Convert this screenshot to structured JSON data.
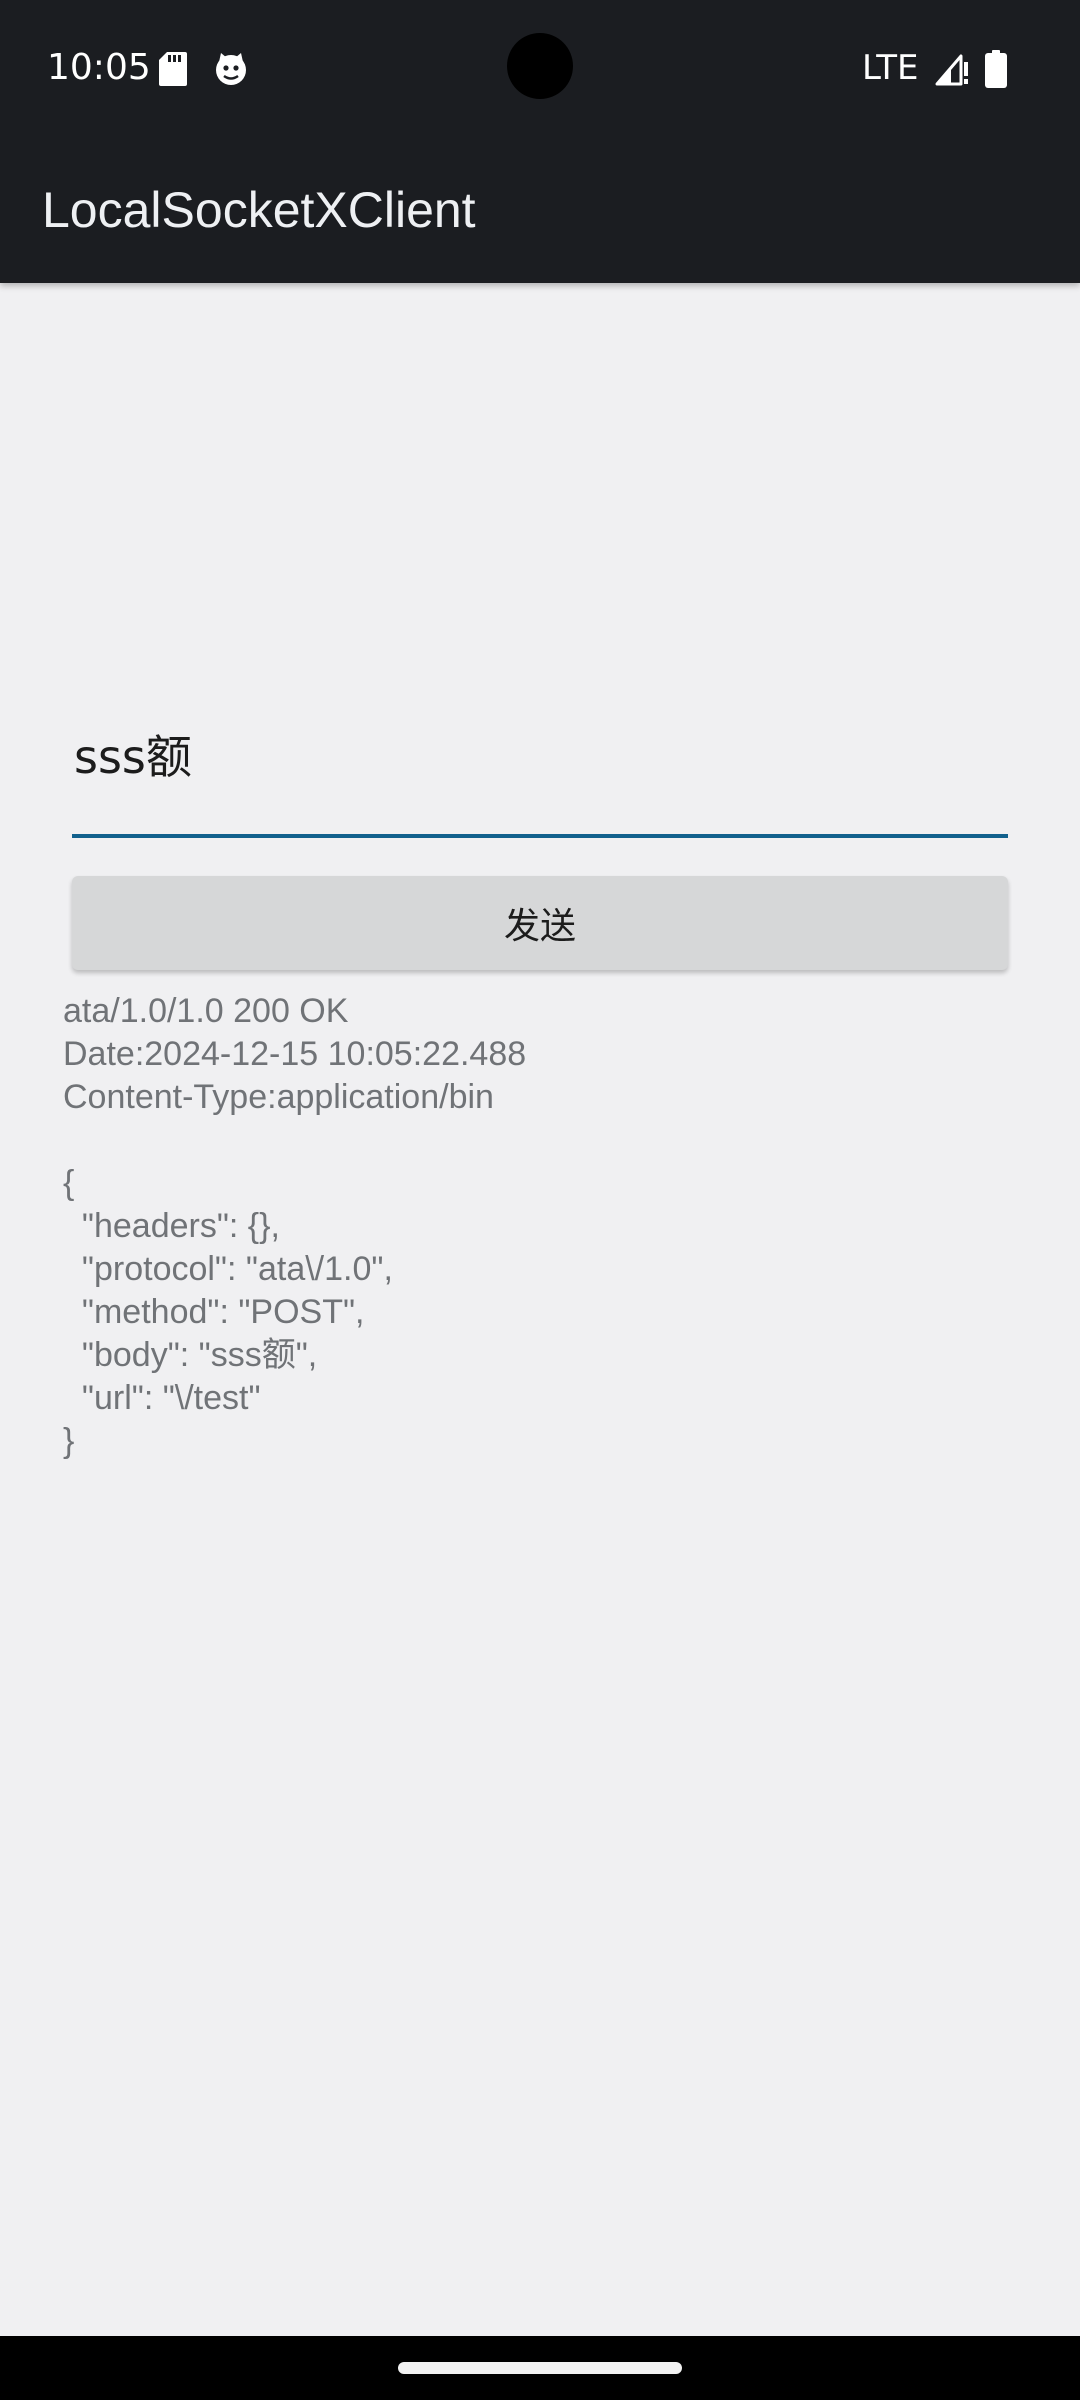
{
  "status_bar": {
    "time": "10:05",
    "network": "LTE",
    "icons": [
      "sd-card-icon",
      "cat-face-icon",
      "signal-icon",
      "battery-icon"
    ]
  },
  "app_bar": {
    "title": "LocalSocketXClient"
  },
  "form": {
    "input_value": "sss额",
    "send_label": "发送"
  },
  "response": {
    "text": "ata/1.0/1.0 200 OK\nDate:2024-12-15 10:05:22.488\nContent-Type:application/bin\n\n{\n  \"headers\": {},\n  \"protocol\": \"ata\\/1.0\",\n  \"method\": \"POST\",\n  \"body\": \"sss额\",\n  \"url\": \"\\/test\"\n}"
  },
  "colors": {
    "app_bar": "#1b1d21",
    "background": "#f0f0f2",
    "input_underline": "#12618d",
    "button": "#d6d7d8",
    "response_text": "#707377"
  }
}
